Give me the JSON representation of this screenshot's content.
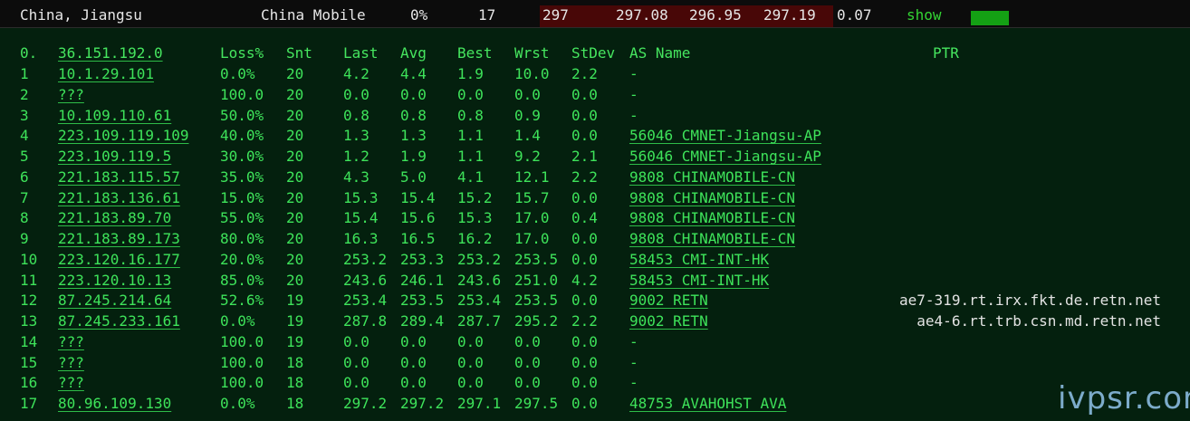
{
  "summary": {
    "location": "China, Jiangsu",
    "isp": "China Mobile",
    "loss": "0%",
    "hops": "17",
    "last": "297",
    "avg": "297.08",
    "best": "296.95",
    "worst": "297.19",
    "stdev": "0.07",
    "show_label": "show",
    "colors": {
      "latency_bg": "#480707",
      "bar": "#14a014",
      "link": "#33d433"
    }
  },
  "table": {
    "headers": {
      "hop": "0.",
      "host": "36.151.192.0",
      "loss": "Loss%",
      "snt": "Snt",
      "last": "Last",
      "avg": "Avg",
      "best": "Best",
      "wrst": "Wrst",
      "stdev": "StDev",
      "as": "AS Name",
      "ptr": "PTR"
    },
    "rows": [
      {
        "hop": "1",
        "host": "10.1.29.101",
        "loss": "0.0%",
        "snt": "20",
        "last": "4.2",
        "avg": "4.4",
        "best": "1.9",
        "wrst": "10.0",
        "stdev": "2.2",
        "as": "-",
        "ptr": ""
      },
      {
        "hop": "2",
        "host": "???",
        "loss": "100.0",
        "snt": "20",
        "last": "0.0",
        "avg": "0.0",
        "best": "0.0",
        "wrst": "0.0",
        "stdev": "0.0",
        "as": "-",
        "ptr": ""
      },
      {
        "hop": "3",
        "host": "10.109.110.61",
        "loss": "50.0%",
        "snt": "20",
        "last": "0.8",
        "avg": "0.8",
        "best": "0.8",
        "wrst": "0.9",
        "stdev": "0.0",
        "as": "-",
        "ptr": ""
      },
      {
        "hop": "4",
        "host": "223.109.119.109",
        "loss": "40.0%",
        "snt": "20",
        "last": "1.3",
        "avg": "1.3",
        "best": "1.1",
        "wrst": "1.4",
        "stdev": "0.0",
        "as": "56046 CMNET-Jiangsu-AP",
        "ptr": ""
      },
      {
        "hop": "5",
        "host": "223.109.119.5",
        "loss": "30.0%",
        "snt": "20",
        "last": "1.2",
        "avg": "1.9",
        "best": "1.1",
        "wrst": "9.2",
        "stdev": "2.1",
        "as": "56046 CMNET-Jiangsu-AP",
        "ptr": ""
      },
      {
        "hop": "6",
        "host": "221.183.115.57",
        "loss": "35.0%",
        "snt": "20",
        "last": "4.3",
        "avg": "5.0",
        "best": "4.1",
        "wrst": "12.1",
        "stdev": "2.2",
        "as": "9808  CHINAMOBILE-CN",
        "ptr": ""
      },
      {
        "hop": "7",
        "host": "221.183.136.61",
        "loss": "15.0%",
        "snt": "20",
        "last": "15.3",
        "avg": "15.4",
        "best": "15.2",
        "wrst": "15.7",
        "stdev": "0.0",
        "as": "9808  CHINAMOBILE-CN",
        "ptr": ""
      },
      {
        "hop": "8",
        "host": "221.183.89.70",
        "loss": "55.0%",
        "snt": "20",
        "last": "15.4",
        "avg": "15.6",
        "best": "15.3",
        "wrst": "17.0",
        "stdev": "0.4",
        "as": "9808  CHINAMOBILE-CN",
        "ptr": ""
      },
      {
        "hop": "9",
        "host": "221.183.89.173",
        "loss": "80.0%",
        "snt": "20",
        "last": "16.3",
        "avg": "16.5",
        "best": "16.2",
        "wrst": "17.0",
        "stdev": "0.0",
        "as": "9808  CHINAMOBILE-CN",
        "ptr": ""
      },
      {
        "hop": "10",
        "host": "223.120.16.177",
        "loss": "20.0%",
        "snt": "20",
        "last": "253.2",
        "avg": "253.3",
        "best": "253.2",
        "wrst": "253.5",
        "stdev": "0.0",
        "as": "58453 CMI-INT-HK",
        "ptr": ""
      },
      {
        "hop": "11",
        "host": "223.120.10.13",
        "loss": "85.0%",
        "snt": "20",
        "last": "243.6",
        "avg": "246.1",
        "best": "243.6",
        "wrst": "251.0",
        "stdev": "4.2",
        "as": "58453 CMI-INT-HK",
        "ptr": ""
      },
      {
        "hop": "12",
        "host": "87.245.214.64",
        "loss": "52.6%",
        "snt": "19",
        "last": "253.4",
        "avg": "253.5",
        "best": "253.4",
        "wrst": "253.5",
        "stdev": "0.0",
        "as": "9002  RETN",
        "ptr": "ae7-319.rt.irx.fkt.de.retn.net"
      },
      {
        "hop": "13",
        "host": "87.245.233.161",
        "loss": "0.0%",
        "snt": "19",
        "last": "287.8",
        "avg": "289.4",
        "best": "287.7",
        "wrst": "295.2",
        "stdev": "2.2",
        "as": "9002  RETN",
        "ptr": "ae4-6.rt.trb.csn.md.retn.net"
      },
      {
        "hop": "14",
        "host": "???",
        "loss": "100.0",
        "snt": "19",
        "last": "0.0",
        "avg": "0.0",
        "best": "0.0",
        "wrst": "0.0",
        "stdev": "0.0",
        "as": "-",
        "ptr": ""
      },
      {
        "hop": "15",
        "host": "???",
        "loss": "100.0",
        "snt": "18",
        "last": "0.0",
        "avg": "0.0",
        "best": "0.0",
        "wrst": "0.0",
        "stdev": "0.0",
        "as": "-",
        "ptr": ""
      },
      {
        "hop": "16",
        "host": "???",
        "loss": "100.0",
        "snt": "18",
        "last": "0.0",
        "avg": "0.0",
        "best": "0.0",
        "wrst": "0.0",
        "stdev": "0.0",
        "as": "-",
        "ptr": ""
      },
      {
        "hop": "17",
        "host": "80.96.109.130",
        "loss": "0.0%",
        "snt": "18",
        "last": "297.2",
        "avg": "297.2",
        "best": "297.1",
        "wrst": "297.5",
        "stdev": "0.0",
        "as": "48753 AVAHOHST AVA",
        "ptr": ""
      }
    ]
  },
  "watermark": "ivpsr.com"
}
